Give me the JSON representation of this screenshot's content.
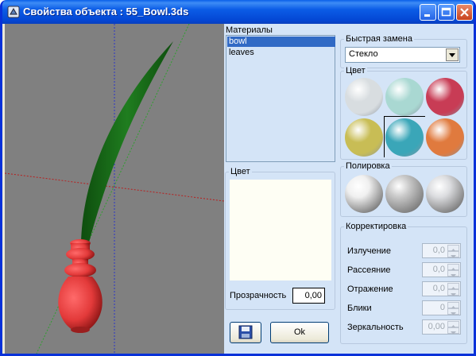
{
  "window": {
    "title": "Свойства объекта : 55_Bowl.3ds"
  },
  "materials": {
    "label": "Материалы",
    "items": [
      "bowl",
      "leaves"
    ],
    "selected": "bowl"
  },
  "color_group": {
    "title": "Цвет",
    "transparency_label": "Прозрачность",
    "transparency_value": "0,00"
  },
  "buttons": {
    "ok": "Ok",
    "save_icon": "floppy-disk-icon"
  },
  "quick_replace": {
    "title": "Быстрая замена",
    "selected": "Стекло"
  },
  "color_presets": {
    "title": "Цвет",
    "colors": [
      "#d8dde0",
      "#a9d8d2",
      "#c83c55",
      "#c8bd55",
      "#3aa6b8",
      "#e07a3e"
    ],
    "selected_index": 4
  },
  "polish": {
    "title": "Полировка",
    "balls": [
      "#f0f0f0",
      "#c8c8c8",
      "#dcdde0"
    ]
  },
  "correction": {
    "title": "Корректировка",
    "rows": [
      {
        "label": "Излучение",
        "value": "0,0"
      },
      {
        "label": "Рассеяние",
        "value": "0,0"
      },
      {
        "label": "Отражение",
        "value": "0,0"
      },
      {
        "label": "Блики",
        "value": "0"
      },
      {
        "label": "Зеркальность",
        "value": "0,00"
      }
    ]
  }
}
